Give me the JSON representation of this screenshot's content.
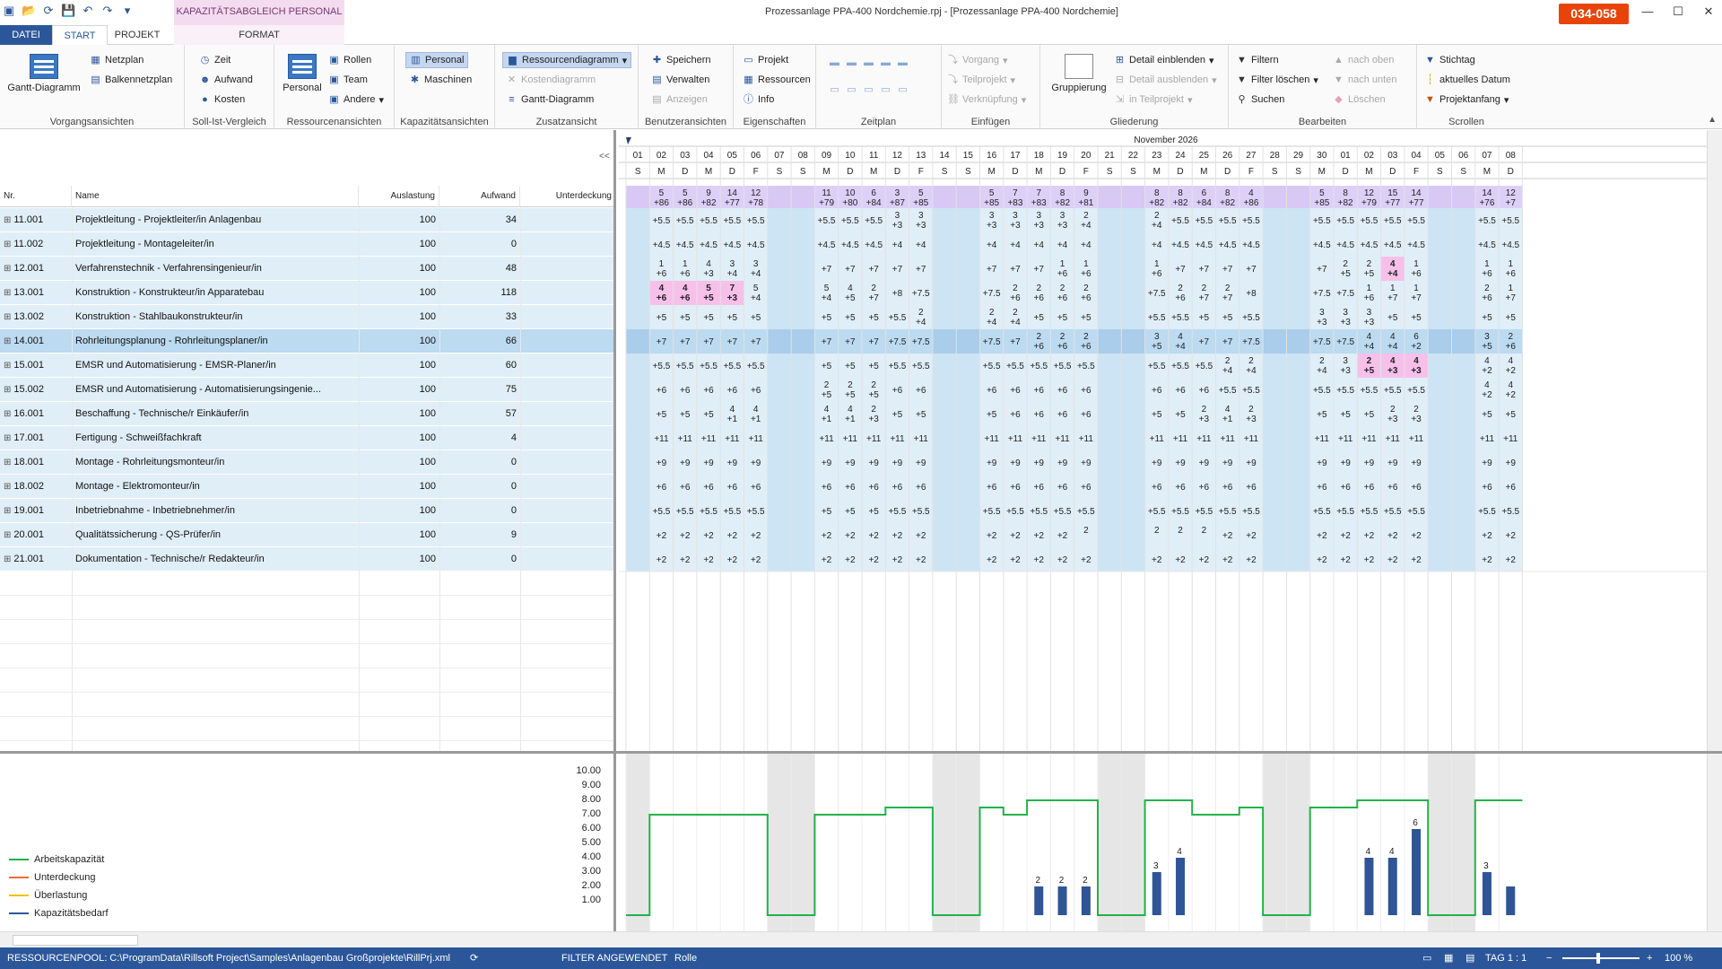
{
  "window": {
    "title": "Prozessanlage PPA-400 Nordchemie.rpj - [Prozessanlage PPA-400 Nordchemie]",
    "badge": "034-058",
    "context_tab": "KAPAZITÄTSABGLEICH PERSONAL"
  },
  "tabs": {
    "datei": "DATEI",
    "start": "START",
    "projekt": "PROJEKT",
    "format": "FORMAT"
  },
  "ribbon": {
    "vorgang": {
      "label": "Vorgangsansichten",
      "gantt": "Gantt-Diagramm",
      "netzplan": "Netzplan",
      "balken": "Balkennetzplan"
    },
    "sollist": {
      "label": "Soll-Ist-Vergleich",
      "zeit": "Zeit",
      "aufwand": "Aufwand",
      "kosten": "Kosten"
    },
    "ressourcen": {
      "label": "Ressourcenansichten",
      "personal": "Personal",
      "rollen": "Rollen",
      "team": "Team",
      "andere": "Andere"
    },
    "kapaz": {
      "label": "Kapazitätsansichten",
      "personal": "Personal",
      "maschinen": "Maschinen"
    },
    "zusatz": {
      "label": "Zusatzansicht",
      "ressdiag": "Ressourcendiagramm",
      "kostdiag": "Kostendiagramm",
      "gantt": "Gantt-Diagramm"
    },
    "benutzer": {
      "label": "Benutzeransichten",
      "speichern": "Speichern",
      "verwalten": "Verwalten",
      "anzeigen": "Anzeigen"
    },
    "eigen": {
      "label": "Eigenschaften",
      "projekt": "Projekt",
      "ressourcen": "Ressourcen",
      "info": "Info"
    },
    "zeitplan": {
      "label": "Zeitplan"
    },
    "einfuegen": {
      "label": "Einfügen",
      "vorgang": "Vorgang",
      "teilprojekt": "Teilprojekt",
      "verkn": "Verknüpfung"
    },
    "gliederung": {
      "label": "Gliederung",
      "gruppierung": "Gruppierung",
      "einblenden": "Detail einblenden",
      "ausblenden": "Detail ausblenden",
      "inteil": "in Teilprojekt"
    },
    "bearbeiten": {
      "label": "Bearbeiten",
      "filtern": "Filtern",
      "filterloeschen": "Filter löschen",
      "suchen": "Suchen",
      "nachoben": "nach oben",
      "nachunten": "nach unten",
      "loeschen": "Löschen"
    },
    "scrollen": {
      "label": "Scrollen",
      "stichtag": "Stichtag",
      "aktuell": "aktuelles Datum",
      "projektanfang": "Projektanfang"
    }
  },
  "table": {
    "collapse": "<<",
    "headers": {
      "nr": "Nr.",
      "name": "Name",
      "auslastung": "Auslastung",
      "aufwand": "Aufwand",
      "unterdeckung": "Unterdeckung"
    },
    "rows": [
      {
        "nr": "11.001",
        "name": "Projektleitung - Projektleiter/in Anlagenbau",
        "aus": "100",
        "auf": "34"
      },
      {
        "nr": "11.002",
        "name": "Projektleitung - Montageleiter/in",
        "aus": "100",
        "auf": "0"
      },
      {
        "nr": "12.001",
        "name": "Verfahrenstechnik - Verfahrensingenieur/in",
        "aus": "100",
        "auf": "48"
      },
      {
        "nr": "13.001",
        "name": "Konstruktion - Konstrukteur/in Apparatebau",
        "aus": "100",
        "auf": "118"
      },
      {
        "nr": "13.002",
        "name": "Konstruktion - Stahlbaukonstrukteur/in",
        "aus": "100",
        "auf": "33"
      },
      {
        "nr": "14.001",
        "name": "Rohrleitungsplanung - Rohrleitungsplaner/in",
        "aus": "100",
        "auf": "66"
      },
      {
        "nr": "15.001",
        "name": "EMSR und Automatisierung - EMSR-Planer/in",
        "aus": "100",
        "auf": "60"
      },
      {
        "nr": "15.002",
        "name": "EMSR und Automatisierung - Automatisierungsingenie...",
        "aus": "100",
        "auf": "75"
      },
      {
        "nr": "16.001",
        "name": "Beschaffung - Technische/r Einkäufer/in",
        "aus": "100",
        "auf": "57"
      },
      {
        "nr": "17.001",
        "name": "Fertigung - Schweißfachkraft",
        "aus": "100",
        "auf": "4"
      },
      {
        "nr": "18.001",
        "name": "Montage - Rohrleitungsmonteur/in",
        "aus": "100",
        "auf": "0"
      },
      {
        "nr": "18.002",
        "name": "Montage - Elektromonteur/in",
        "aus": "100",
        "auf": "0"
      },
      {
        "nr": "19.001",
        "name": "Inbetriebnahme - Inbetriebnehmer/in",
        "aus": "100",
        "auf": "0"
      },
      {
        "nr": "20.001",
        "name": "Qualitätssicherung - QS-Prüfer/in",
        "aus": "100",
        "auf": "9"
      },
      {
        "nr": "21.001",
        "name": "Dokumentation - Technische/r Redakteur/in",
        "aus": "100",
        "auf": "0"
      }
    ]
  },
  "timeline": {
    "month": "November 2026",
    "days": [
      "01",
      "02",
      "03",
      "04",
      "05",
      "06",
      "07",
      "08",
      "09",
      "10",
      "11",
      "12",
      "13",
      "14",
      "15",
      "16",
      "17",
      "18",
      "19",
      "20",
      "21",
      "22",
      "23",
      "24",
      "25",
      "26",
      "27",
      "28",
      "29",
      "30",
      "01",
      "02",
      "03",
      "04",
      "05",
      "06",
      "07",
      "08"
    ],
    "weekdays": [
      "S",
      "M",
      "D",
      "M",
      "D",
      "F",
      "S",
      "S",
      "M",
      "D",
      "M",
      "D",
      "F",
      "S",
      "S",
      "M",
      "D",
      "M",
      "D",
      "F",
      "S",
      "S",
      "M",
      "D",
      "M",
      "D",
      "F",
      "S",
      "S",
      "M",
      "D",
      "M",
      "D",
      "F",
      "S",
      "S",
      "M",
      "D"
    ],
    "summary": [
      [
        "",
        ""
      ],
      [
        "5",
        "+86"
      ],
      [
        "5",
        "+86"
      ],
      [
        "9",
        "+82"
      ],
      [
        "14",
        "+77"
      ],
      [
        "12",
        "+78"
      ],
      [
        "",
        ""
      ],
      [
        "",
        ""
      ],
      [
        "11",
        "+79"
      ],
      [
        "10",
        "+80"
      ],
      [
        "6",
        "+84"
      ],
      [
        "3",
        "+87"
      ],
      [
        "5",
        "+85"
      ],
      [
        "",
        ""
      ],
      [
        "",
        ""
      ],
      [
        "5",
        "+85"
      ],
      [
        "7",
        "+83"
      ],
      [
        "7",
        "+83"
      ],
      [
        "8",
        "+82"
      ],
      [
        "9",
        "+81"
      ],
      [
        "",
        ""
      ],
      [
        "",
        ""
      ],
      [
        "8",
        "+82"
      ],
      [
        "8",
        "+82"
      ],
      [
        "6",
        "+84"
      ],
      [
        "8",
        "+82"
      ],
      [
        "4",
        "+86"
      ],
      [
        "",
        ""
      ],
      [
        "",
        ""
      ],
      [
        "5",
        "+85"
      ],
      [
        "8",
        "+82"
      ],
      [
        "12",
        "+79"
      ],
      [
        "15",
        "+77"
      ],
      [
        "14",
        "+77"
      ],
      [
        "",
        ""
      ],
      [
        "",
        ""
      ],
      [
        "14",
        "+76"
      ],
      [
        "12",
        "+7"
      ]
    ],
    "cells": [
      [
        "",
        "+5.5",
        "+5.5",
        "+5.5",
        "+5.5",
        "+5.5",
        "",
        "",
        "+5.5",
        "+5.5",
        "+5.5",
        "3|+3",
        "3|+3",
        "",
        "",
        "3|+3",
        "3|+3",
        "3|+3",
        "3|+3",
        "2|+4",
        "",
        "",
        "2|+4",
        "+5.5",
        "+5.5",
        "+5.5",
        "+5.5",
        "",
        "",
        "+5.5",
        "+5.5",
        "+5.5",
        "+5.5",
        "+5.5",
        "",
        "",
        "+5.5",
        "+5.5"
      ],
      [
        "",
        "+4.5",
        "+4.5",
        "+4.5",
        "+4.5",
        "+4.5",
        "",
        "",
        "+4.5",
        "+4.5",
        "+4.5",
        "+4",
        "+4",
        "",
        "",
        "+4",
        "+4",
        "+4",
        "+4",
        "+4",
        "",
        "",
        "+4",
        "+4.5",
        "+4.5",
        "+4.5",
        "+4.5",
        "",
        "",
        "+4.5",
        "+4.5",
        "+4.5",
        "+4.5",
        "+4.5",
        "",
        "",
        "+4.5",
        "+4.5"
      ],
      [
        "",
        "1|+6",
        "1|+6",
        "4|+3",
        "3|+4",
        "3|+4",
        "",
        "",
        "+7",
        "+7",
        "+7",
        "+7",
        "+7",
        "",
        "",
        "+7",
        "+7",
        "+7",
        "1|+6",
        "1|+6",
        "",
        "",
        "1|+6",
        "+7",
        "+7",
        "+7",
        "+7",
        "",
        "",
        "+7",
        "2|+5",
        "2|+5",
        "4|+4",
        "1|+6",
        "",
        "",
        "1|+6",
        "1|+6"
      ],
      [
        "",
        "4|+6",
        "4|+6",
        "5|+5",
        "7|+3",
        "5|+4",
        "",
        "",
        "5|+4",
        "4|+5",
        "2|+7",
        "+8",
        "+7.5",
        "",
        "",
        "+7.5",
        "2|+6",
        "2|+6",
        "2|+6",
        "2|+6",
        "",
        "",
        "+7.5",
        "2|+6",
        "2|+7",
        "2|+7",
        "+8",
        "",
        "",
        "+7.5",
        "+7.5",
        "1|+6",
        "1|+7",
        "1|+7",
        "",
        "",
        "2|+6",
        "1|+7"
      ],
      [
        "",
        "+5",
        "+5",
        "+5",
        "+5",
        "+5",
        "",
        "",
        "+5",
        "+5",
        "+5",
        "+5.5",
        "2|+4",
        "",
        "",
        "2|+4",
        "2|+4",
        "+5",
        "+5",
        "+5",
        "",
        "",
        "+5.5",
        "+5.5",
        "+5",
        "+5",
        "+5.5",
        "",
        "",
        "3|+3",
        "3|+3",
        "3|+3",
        "+5",
        "+5",
        "",
        "",
        "+5",
        "+5"
      ],
      [
        "",
        "+7",
        "+7",
        "+7",
        "+7",
        "+7",
        "",
        "",
        "+7",
        "+7",
        "+7",
        "+7.5",
        "+7.5",
        "",
        "",
        "+7.5",
        "+7",
        "2|+6",
        "2|+6",
        "2|+6",
        "",
        "",
        "3|+5",
        "4|+4",
        "+7",
        "+7",
        "+7.5",
        "",
        "",
        "+7.5",
        "+7.5",
        "4|+4",
        "4|+4",
        "6|+2",
        "",
        "",
        "3|+5",
        "2|+6"
      ],
      [
        "",
        "+5.5",
        "+5.5",
        "+5.5",
        "+5.5",
        "+5.5",
        "",
        "",
        "+5",
        "+5",
        "+5",
        "+5.5",
        "+5.5",
        "",
        "",
        "+5.5",
        "+5.5",
        "+5.5",
        "+5.5",
        "+5.5",
        "",
        "",
        "+5.5",
        "+5.5",
        "+5.5",
        "2|+4",
        "2|+4",
        "",
        "",
        "2|+4",
        "3|+3",
        "2|+5",
        "4|+3",
        "4|+3",
        "",
        "",
        "4|+2",
        "4|+2"
      ],
      [
        "",
        "+6",
        "+6",
        "+6",
        "+6",
        "+6",
        "",
        "",
        "2|+5",
        "2|+5",
        "2|+5",
        "+6",
        "+6",
        "",
        "",
        "+6",
        "+6",
        "+6",
        "+6",
        "+6",
        "",
        "",
        "+6",
        "+6",
        "+6",
        "+5.5",
        "+5.5",
        "",
        "",
        "+5.5",
        "+5.5",
        "+5.5",
        "+5.5",
        "+5.5",
        "",
        "",
        "4|+2",
        "4|+2"
      ],
      [
        "",
        "+5",
        "+5",
        "+5",
        "4|+1",
        "4|+1",
        "",
        "",
        "4|+1",
        "4|+1",
        "2|+3",
        "+5",
        "+5",
        "",
        "",
        "+5",
        "+6",
        "+6",
        "+6",
        "+6",
        "",
        "",
        "+5",
        "+5",
        "2|+3",
        "4|+1",
        "2|+3",
        "",
        "",
        "+5",
        "+5",
        "+5",
        "2|+3",
        "2|+3",
        "",
        "",
        "+5",
        "+5"
      ],
      [
        "",
        "+11",
        "+11",
        "+11",
        "+11",
        "+11",
        "",
        "",
        "+11",
        "+11",
        "+11",
        "+11",
        "+11",
        "",
        "",
        "+11",
        "+11",
        "+11",
        "+11",
        "+11",
        "",
        "",
        "+11",
        "+11",
        "+11",
        "+11",
        "+11",
        "",
        "",
        "+11",
        "+11",
        "+11",
        "+11",
        "+11",
        "",
        "",
        "+11",
        "+11"
      ],
      [
        "",
        "+9",
        "+9",
        "+9",
        "+9",
        "+9",
        "",
        "",
        "+9",
        "+9",
        "+9",
        "+9",
        "+9",
        "",
        "",
        "+9",
        "+9",
        "+9",
        "+9",
        "+9",
        "",
        "",
        "+9",
        "+9",
        "+9",
        "+9",
        "+9",
        "",
        "",
        "+9",
        "+9",
        "+9",
        "+9",
        "+9",
        "",
        "",
        "+9",
        "+9"
      ],
      [
        "",
        "+6",
        "+6",
        "+6",
        "+6",
        "+6",
        "",
        "",
        "+6",
        "+6",
        "+6",
        "+6",
        "+6",
        "",
        "",
        "+6",
        "+6",
        "+6",
        "+6",
        "+6",
        "",
        "",
        "+6",
        "+6",
        "+6",
        "+6",
        "+6",
        "",
        "",
        "+6",
        "+6",
        "+6",
        "+6",
        "+6",
        "",
        "",
        "+6",
        "+6"
      ],
      [
        "",
        "+5.5",
        "+5.5",
        "+5.5",
        "+5.5",
        "+5.5",
        "",
        "",
        "+5",
        "+5",
        "+5",
        "+5.5",
        "+5.5",
        "",
        "",
        "+5.5",
        "+5.5",
        "+5.5",
        "+5.5",
        "+5.5",
        "",
        "",
        "+5.5",
        "+5.5",
        "+5.5",
        "+5.5",
        "+5.5",
        "",
        "",
        "+5.5",
        "+5.5",
        "+5.5",
        "+5.5",
        "+5.5",
        "",
        "",
        "+5.5",
        "+5.5"
      ],
      [
        "",
        "+2",
        "+2",
        "+2",
        "+2",
        "+2",
        "",
        "",
        "+2",
        "+2",
        "+2",
        "+2",
        "+2",
        "",
        "",
        "+2",
        "+2",
        "+2",
        "+2",
        "2",
        "",
        "",
        "2",
        "2",
        "2",
        "+2",
        "+2",
        "",
        "",
        "+2",
        "+2",
        "+2",
        "+2",
        "+2",
        "",
        "",
        "+2",
        "+2"
      ],
      [
        "",
        "+2",
        "+2",
        "+2",
        "+2",
        "+2",
        "",
        "",
        "+2",
        "+2",
        "+2",
        "+2",
        "+2",
        "",
        "",
        "+2",
        "+2",
        "+2",
        "+2",
        "+2",
        "",
        "",
        "+2",
        "+2",
        "+2",
        "+2",
        "+2",
        "",
        "",
        "+2",
        "+2",
        "+2",
        "+2",
        "+2",
        "",
        "",
        "+2",
        "+2"
      ]
    ],
    "overloaded": [
      [
        3,
        1
      ],
      [
        3,
        2
      ],
      [
        3,
        3
      ],
      [
        3,
        4
      ],
      [
        2,
        32
      ],
      [
        6,
        31
      ],
      [
        6,
        32
      ],
      [
        6,
        33
      ]
    ]
  },
  "legend": {
    "arbeit": "Arbeitskapazität",
    "unter": "Unterdeckung",
    "ueber": "Überlastung",
    "bedarf": "Kapazitätsbedarf",
    "colors": {
      "arbeit": "#22b24c",
      "unter": "#f26b3a",
      "ueber": "#f2c200",
      "bedarf": "#2f5597"
    }
  },
  "chart_data": {
    "type": "line",
    "ylim": [
      0,
      10
    ],
    "yticks": [
      "10.00",
      "9.00",
      "8.00",
      "7.00",
      "6.00",
      "5.00",
      "4.00",
      "3.00",
      "2.00",
      "1.00"
    ],
    "capacity": [
      0,
      7,
      7,
      7,
      7,
      7,
      0,
      0,
      7,
      7,
      7,
      7.5,
      7.5,
      0,
      0,
      7.5,
      7,
      8,
      8,
      8,
      0,
      0,
      8,
      8,
      7,
      7,
      7.5,
      0,
      0,
      7.5,
      7.5,
      8,
      8,
      8,
      0,
      0,
      8,
      8
    ],
    "demand": [
      0,
      0,
      0,
      0,
      0,
      0,
      0,
      0,
      0,
      0,
      0,
      0,
      0,
      0,
      0,
      0,
      0,
      2,
      2,
      2,
      0,
      0,
      3,
      4,
      0,
      0,
      0,
      0,
      0,
      0,
      0,
      4,
      4,
      6,
      0,
      0,
      3,
      2
    ],
    "demand_labels": [
      "",
      "",
      "",
      "",
      "",
      "",
      "",
      "",
      "",
      "",
      "",
      "",
      "",
      "",
      "",
      "",
      "",
      "2",
      "2",
      "2",
      "",
      "",
      "3",
      "4",
      "",
      "",
      "",
      "",
      "",
      "",
      "",
      "4",
      "4",
      "6",
      "",
      "",
      "3",
      ""
    ]
  },
  "status": {
    "pool": "RESSOURCENPOOL: C:\\ProgramData\\Rillsoft Project\\Samples\\Anlagenbau Großprojekte\\RillPrj.xml",
    "filter": "FILTER ANGEWENDET",
    "rolle": "Rolle",
    "tag": "TAG 1 : 1",
    "zoom": "100 %"
  }
}
